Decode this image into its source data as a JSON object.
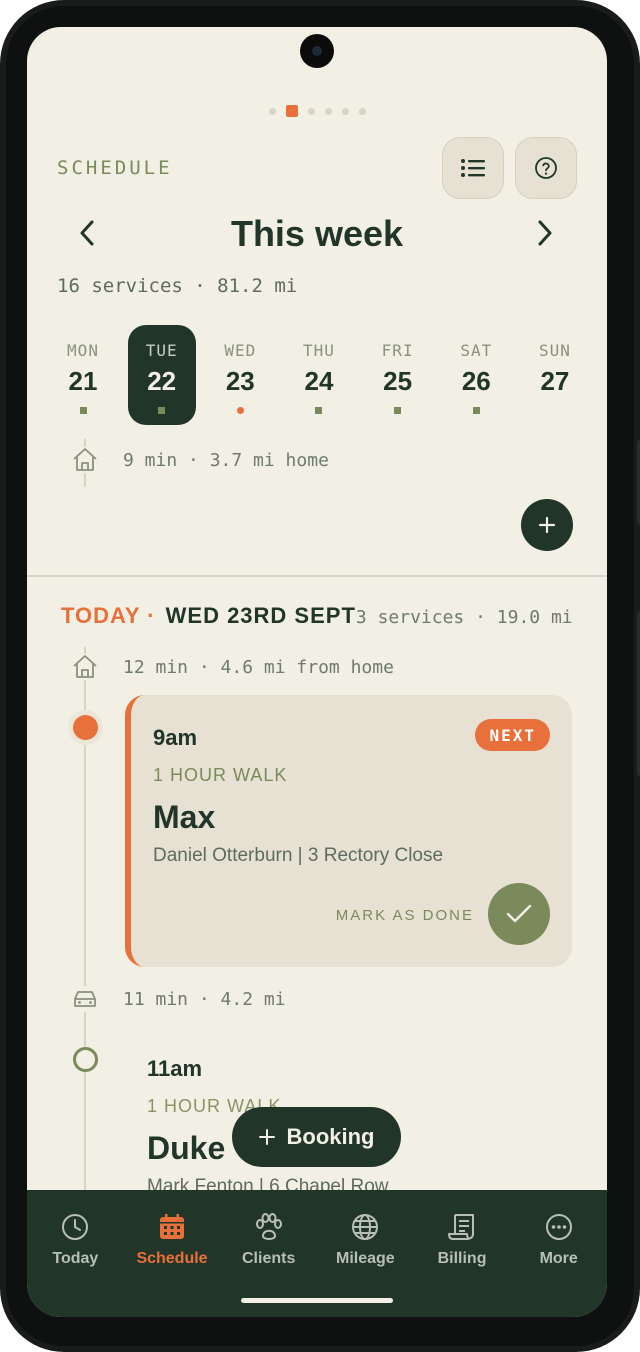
{
  "header": {
    "section_label": "SCHEDULE",
    "week_title": "This week",
    "week_summary": "16 services · 81.2 mi",
    "list_icon": "list-icon",
    "help_icon": "help-circle-icon"
  },
  "pager": {
    "count": 6,
    "active_index": 1
  },
  "days": [
    {
      "name": "MON",
      "date": "21",
      "marker": "square"
    },
    {
      "name": "TUE",
      "date": "22",
      "marker": "square",
      "selected": true
    },
    {
      "name": "WED",
      "date": "23",
      "marker": "dot"
    },
    {
      "name": "THU",
      "date": "24",
      "marker": "square"
    },
    {
      "name": "FRI",
      "date": "25",
      "marker": "square"
    },
    {
      "name": "SAT",
      "date": "26",
      "marker": "square"
    },
    {
      "name": "SUN",
      "date": "27",
      "marker": "none"
    }
  ],
  "selected_day_home": "9 min · 3.7 mi home",
  "today": {
    "label": "TODAY ·",
    "date": "WED 23RD SEPT",
    "summary": "3 services · 19.0 mi",
    "from_home": "12 min · 4.6 mi from home"
  },
  "appointments": [
    {
      "time": "9am",
      "badge": "NEXT",
      "service": "1 HOUR WALK",
      "pet": "Max",
      "address": "Daniel Otterburn | 3 Rectory Close",
      "action_label": "MARK AS DONE"
    },
    {
      "travel": "11 min · 4.2 mi",
      "time": "11am",
      "service": "1 HOUR WALK",
      "pet": "Duke",
      "address": "Mark Fenton | 6 Chapel Row"
    }
  ],
  "booking_button": {
    "icon": "plus-icon",
    "label": "Booking"
  },
  "nav": [
    {
      "label": "Today",
      "icon": "clock-icon"
    },
    {
      "label": "Schedule",
      "icon": "calendar-icon",
      "active": true
    },
    {
      "label": "Clients",
      "icon": "paw-icon"
    },
    {
      "label": "Mileage",
      "icon": "globe-icon"
    },
    {
      "label": "Billing",
      "icon": "receipt-icon"
    },
    {
      "label": "More",
      "icon": "more-icon"
    }
  ],
  "colors": {
    "background": "#f2efe4",
    "primary_dark": "#213529",
    "accent": "#e8703a",
    "olive": "#7b8a5a"
  }
}
